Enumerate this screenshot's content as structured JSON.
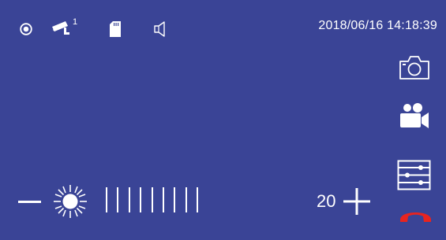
{
  "colors": {
    "background": "#3a4496",
    "foreground": "#ffffff",
    "hangup": "#e8241f"
  },
  "status_bar": {
    "icons": [
      "record-indicator-icon",
      "camera-icon",
      "sd-card-icon",
      "speaker-icon"
    ],
    "camera_index": "1",
    "datetime": "2018/06/16 14:18:39"
  },
  "side_buttons": [
    "snapshot-camera-icon",
    "video-record-icon",
    "settings-sliders-icon",
    "hang-up-icon"
  ],
  "brightness": {
    "icon": "brightness-sun-icon",
    "value": "20",
    "level_bar_count": 9
  }
}
